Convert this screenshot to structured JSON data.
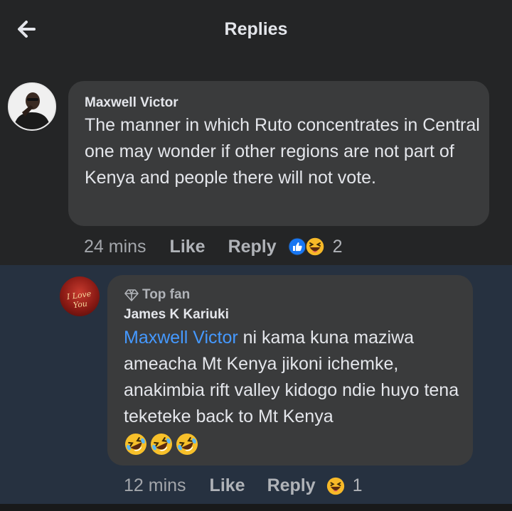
{
  "header": {
    "title": "Replies",
    "back_icon": "arrow-left-icon"
  },
  "comment": {
    "author": "Maxwell Victor",
    "text": "The manner in which Ruto concentrates in Central one may wonder if other regions are not part of Kenya and people there will not vote.",
    "time": "24 mins",
    "like_label": "Like",
    "reply_label": "Reply",
    "reactions": [
      "like",
      "haha"
    ],
    "reaction_count": "2"
  },
  "reply": {
    "badge": "Top fan",
    "author": "James K Kariuki",
    "mention": "Maxwell Victor",
    "text": " ni kama kuna  maziwa ameacha Mt Kenya jikoni ichemke, anakimbia rift valley kidogo ndie huyo tena teketeke back to Mt Kenya",
    "emoji": [
      "rofl",
      "rofl",
      "rofl"
    ],
    "avatar_text": "I Love You",
    "time": "12 mins",
    "like_label": "Like",
    "reply_label": "Reply",
    "reactions": [
      "haha"
    ],
    "reaction_count": "1"
  },
  "colors": {
    "background": "#242526",
    "bubble": "#3a3b3c",
    "reply_bg": "#263140",
    "mention": "#4599ff"
  }
}
